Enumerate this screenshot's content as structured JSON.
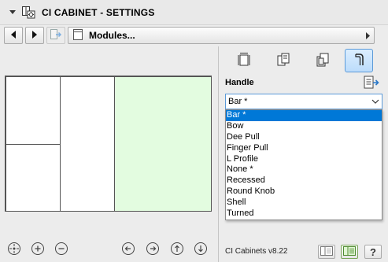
{
  "window": {
    "title": "CI CABINET - SETTINGS"
  },
  "nav": {
    "module_label": "Modules..."
  },
  "handle": {
    "section_label": "Handle",
    "selected_value": "Bar *",
    "options": [
      "Bar *",
      "Bow",
      "Dee Pull",
      "Finger Pull",
      "L Profile",
      "None *",
      "Recessed",
      "Round Knob",
      "Shell",
      "Turned"
    ]
  },
  "footer": {
    "version": "CI Cabinets v8.22"
  },
  "colors": {
    "accent": "#0078d7",
    "active_panel": "#e3fce0",
    "tab_selected_border": "#5b9ad8"
  },
  "icons": {
    "collapse": "triangle-down-icon",
    "app": "cabinet-settings-icon",
    "nav_prev": "arrow-left-icon",
    "nav_next": "arrow-right-icon",
    "nav_module": "module-export-icon",
    "zoom": [
      "zoom-fit-icon",
      "zoom-in-icon",
      "zoom-out-icon",
      "rotate-left-icon",
      "rotate-right-icon",
      "view-front-icon",
      "view-down-icon"
    ],
    "tabs": [
      "dimensions-icon",
      "door-panels-icon",
      "layers-icon",
      "handle-icon"
    ]
  }
}
